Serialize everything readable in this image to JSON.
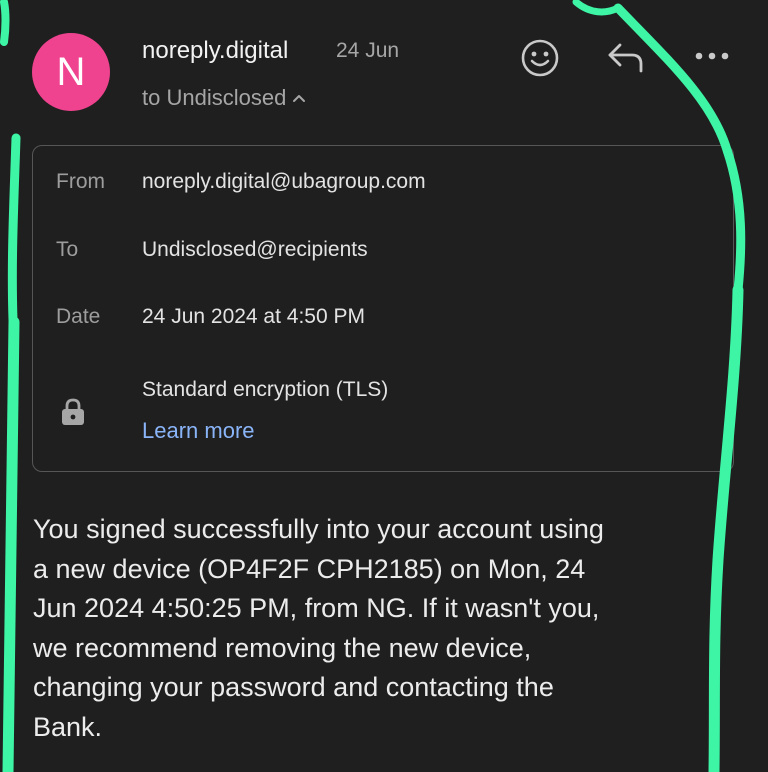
{
  "header": {
    "avatar_letter": "N",
    "sender": "noreply.digital",
    "date": "24 Jun",
    "recipient_summary": "to Undisclosed",
    "icons": {
      "react": "smiley-icon",
      "reply": "reply-icon",
      "more": "more-icon",
      "toggle": "chevron-up-icon"
    }
  },
  "details": {
    "from_label": "From",
    "from_value": "noreply.digital@ubagroup.com",
    "to_label": "To",
    "to_value": "Undisclosed@recipients",
    "date_label": "Date",
    "date_value": "24 Jun 2024 at 4:50 PM",
    "encryption": "Standard encryption (TLS)",
    "learn_more": "Learn more",
    "lock_icon": "lock-icon"
  },
  "message": {
    "body": "You signed successfully into your account using\na new device (OP4F2F CPH2185) on Mon, 24\nJun 2024 4:50:25 PM, from NG. If it wasn't you,\nwe recommend removing the new device,\nchanging your password and contacting the\nBank."
  },
  "colors": {
    "background": "#1f1f1f",
    "avatar": "#f0438f",
    "link": "#8ab4f8",
    "annotation": "#3df5a5"
  }
}
